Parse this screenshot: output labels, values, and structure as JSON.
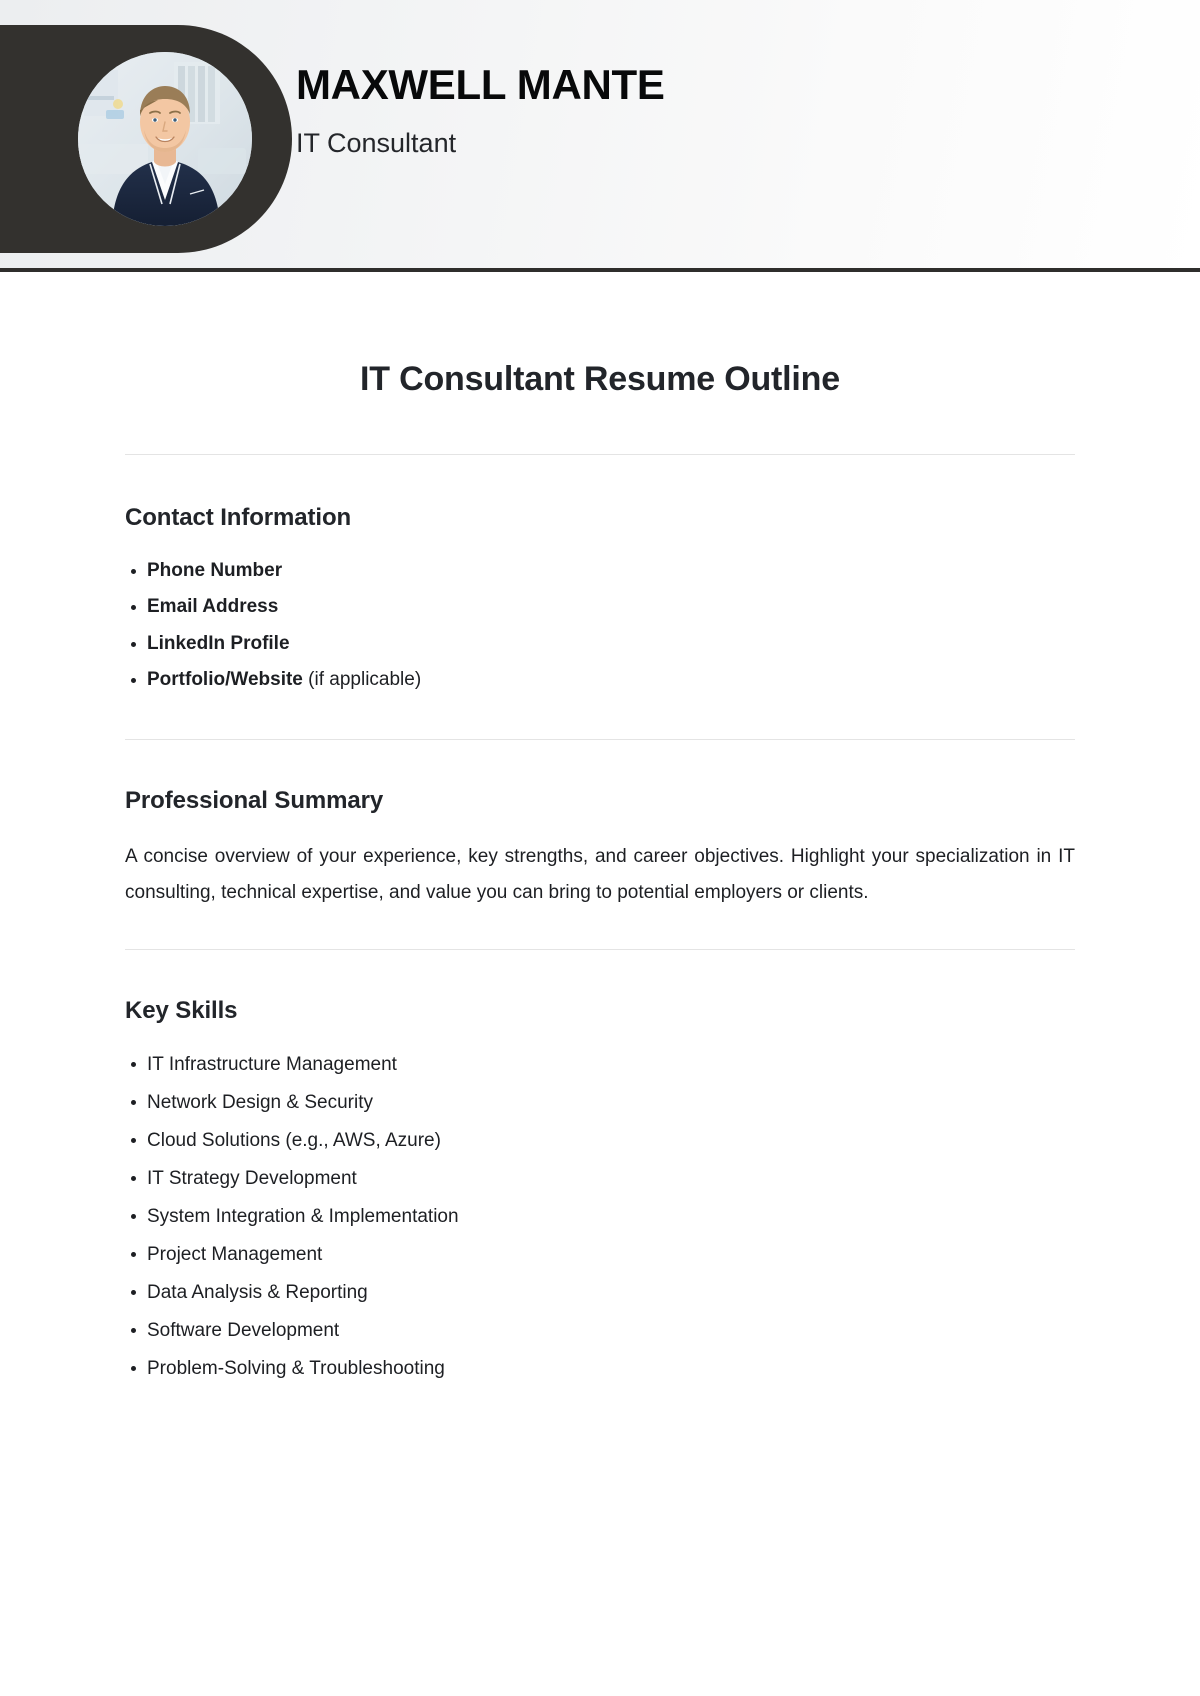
{
  "header": {
    "name": "MAXWELL MANTE",
    "role": "IT Consultant",
    "avatar_alt": "portrait-photo",
    "shape_color": "#33312e",
    "rule_color": "#2f2e2c"
  },
  "document": {
    "title": "IT Consultant Resume Outline",
    "title_color": "#22252a"
  },
  "sections": {
    "contact": {
      "heading": "Contact Information",
      "items": [
        {
          "label": "Phone Number",
          "note": ""
        },
        {
          "label": "Email Address",
          "note": ""
        },
        {
          "label": "LinkedIn Profile",
          "note": ""
        },
        {
          "label": "Portfolio/Website",
          "note": " (if applicable)"
        }
      ]
    },
    "summary": {
      "heading": "Professional Summary",
      "body": "A concise overview of your experience, key strengths, and career objectives. Highlight your specialization in IT consulting, technical expertise, and value you can bring to potential employers or clients."
    },
    "skills": {
      "heading": "Key Skills",
      "items": [
        "IT Infrastructure Management",
        "Network Design & Security",
        "Cloud Solutions (e.g., AWS, Azure)",
        "IT Strategy Development",
        "System Integration & Implementation",
        "Project Management",
        "Data Analysis & Reporting",
        "Software Development",
        "Problem-Solving & Troubleshooting"
      ]
    }
  }
}
